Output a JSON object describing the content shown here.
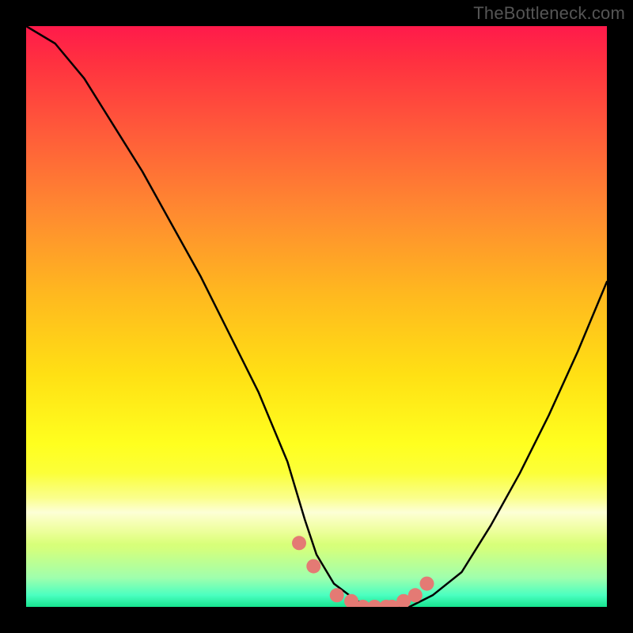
{
  "attribution": "TheBottleneck.com",
  "chart_data": {
    "type": "line",
    "title": "",
    "xlabel": "",
    "ylabel": "",
    "xlim": [
      0,
      100
    ],
    "ylim": [
      0,
      100
    ],
    "series": [
      {
        "name": "bottleneck-curve",
        "x": [
          0,
          5,
          10,
          15,
          20,
          25,
          30,
          35,
          40,
          45,
          48,
          50,
          53,
          57,
          60,
          63,
          66,
          70,
          75,
          80,
          85,
          90,
          95,
          100
        ],
        "y": [
          100,
          97,
          91,
          83,
          75,
          66,
          57,
          47,
          37,
          25,
          15,
          9,
          4,
          1,
          0,
          0,
          0,
          2,
          6,
          14,
          23,
          33,
          44,
          56
        ]
      }
    ],
    "markers": {
      "name": "highlight-points",
      "color": "#e47a74",
      "x": [
        47,
        49.5,
        53.5,
        56,
        58,
        60,
        62,
        63,
        65,
        67,
        69
      ],
      "y": [
        11,
        7,
        2,
        1,
        0,
        0,
        0,
        0,
        1,
        2,
        4
      ]
    },
    "background_gradient": {
      "top": "#ff1a4b",
      "mid": "#ffe014",
      "bottom": "#17e48f"
    }
  }
}
